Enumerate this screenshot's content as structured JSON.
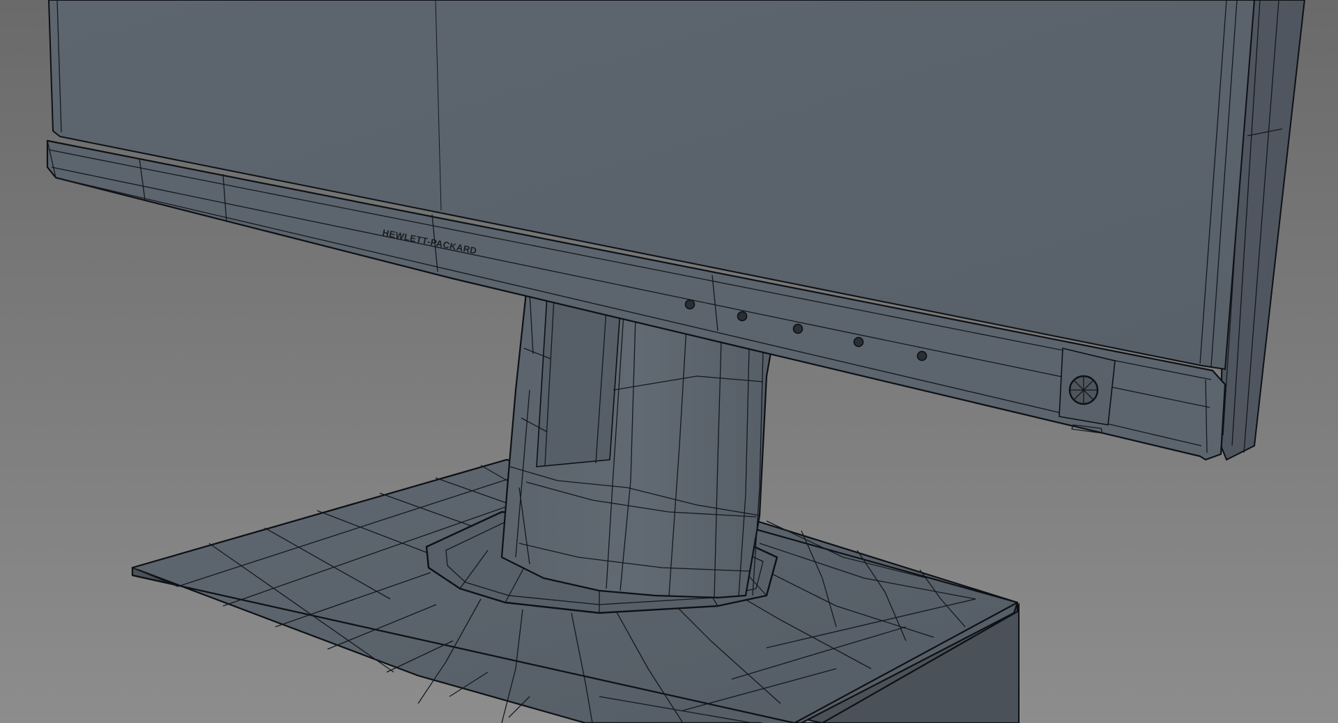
{
  "model": {
    "brand_logo": "HEWLETT-PACKARD",
    "subject": "monitor-wireframe-render"
  },
  "colors": {
    "background_top": "#6e6e6e",
    "background_bottom": "#8c8c8c",
    "surface": "#5a626b",
    "surface_dark": "#4c535c",
    "surface_light": "#69717a",
    "wire": "#14181d"
  },
  "panel_buttons": {
    "count": 5
  }
}
